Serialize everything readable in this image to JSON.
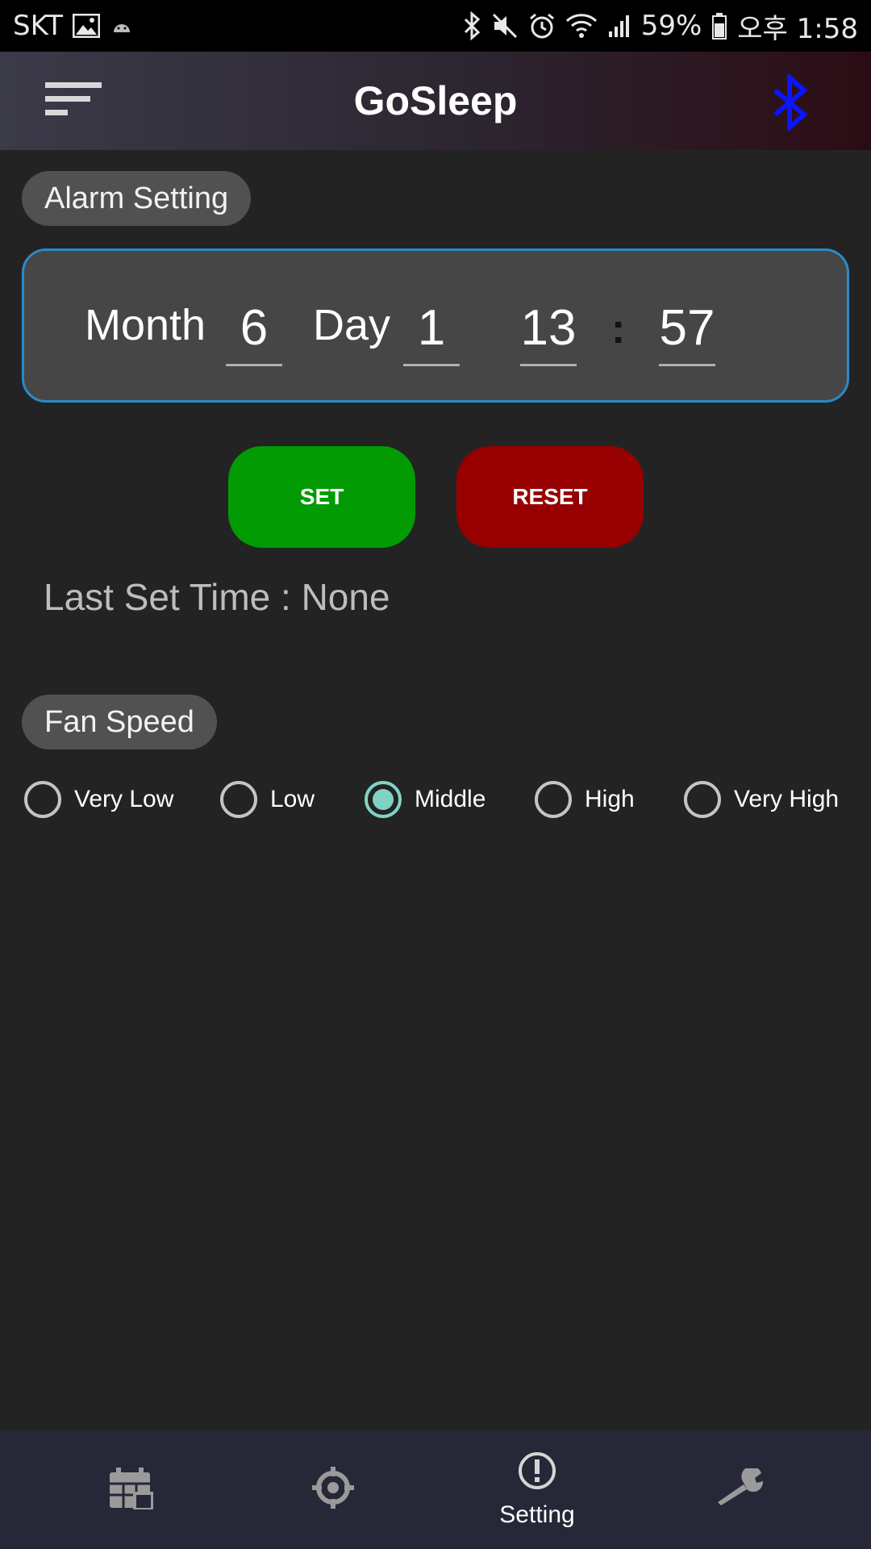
{
  "status_bar": {
    "carrier": "SKT",
    "battery": "59%",
    "time": "오후 1:58",
    "icons": [
      "gallery-icon",
      "android-icon",
      "bluetooth-icon",
      "mute-icon",
      "alarm-icon",
      "wifi-icon",
      "signal-icon",
      "battery-icon"
    ]
  },
  "app_bar": {
    "title": "GoSleep",
    "menu_icon": "sort-menu-icon",
    "bluetooth_icon": "bluetooth-icon",
    "bluetooth_color": "#0a14ff"
  },
  "alarm": {
    "section_label": "Alarm Setting",
    "month_label": "Month",
    "month_value": "6",
    "day_label": "Day",
    "day_value": "1",
    "hour_value": "13",
    "separator": ":",
    "minute_value": "57",
    "set_label": "SET",
    "reset_label": "RESET",
    "last_set_text": "Last Set Time : None"
  },
  "fan": {
    "section_label": "Fan Speed",
    "options": [
      "Very Low",
      "Low",
      "Middle",
      "High",
      "Very High"
    ],
    "selected": "Middle"
  },
  "bottom_nav": {
    "items": [
      {
        "icon": "calendar-icon",
        "label": ""
      },
      {
        "icon": "crosshair-icon",
        "label": ""
      },
      {
        "icon": "info-icon",
        "label": "Setting"
      },
      {
        "icon": "wrench-icon",
        "label": ""
      }
    ],
    "active_index": 2
  },
  "colors": {
    "accent": "#7ed3c6",
    "set_button": "#029b04",
    "reset_button": "#960000",
    "alarm_border": "#2c89c9"
  }
}
